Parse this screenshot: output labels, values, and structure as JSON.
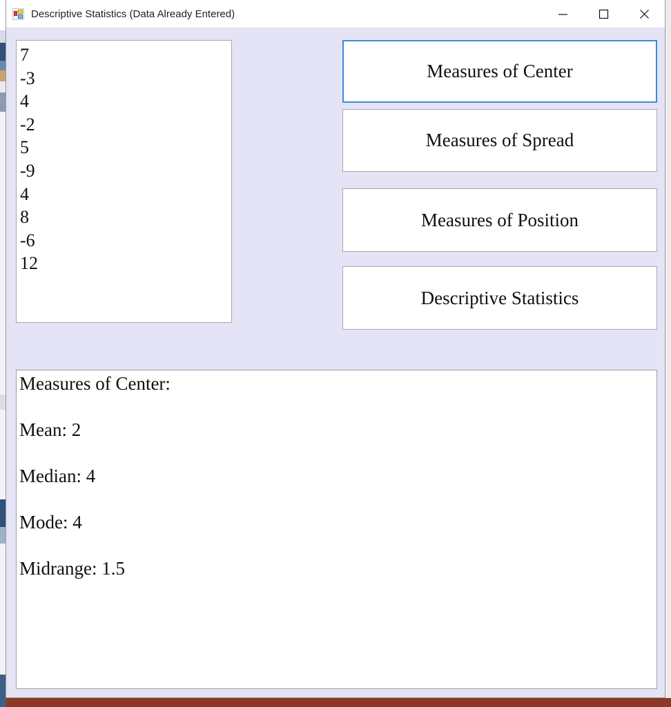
{
  "window": {
    "title": "Descriptive Statistics (Data Already Entered)",
    "icon": "winforms-app-icon",
    "background_color": "#e4e4f6",
    "titlebar_color": "#ffffff",
    "controls": [
      {
        "name": "minimize",
        "glyph": "minimize-icon"
      },
      {
        "name": "maximize",
        "glyph": "maximize-icon"
      },
      {
        "name": "close",
        "glyph": "close-icon"
      }
    ]
  },
  "data_list": {
    "name": "data-values-listbox",
    "values": [
      "7",
      "-3",
      "4",
      "-2",
      "5",
      "-9",
      "4",
      "8",
      "-6",
      "12"
    ]
  },
  "buttons": [
    {
      "id": "measures-of-center",
      "label": "Measures of Center",
      "focused": true,
      "focus_color": "#3d8bd4"
    },
    {
      "id": "measures-of-spread",
      "label": "Measures of Spread",
      "focused": false,
      "border_color": "#a7a7a7"
    },
    {
      "id": "measures-of-position",
      "label": "Measures of Position",
      "focused": false,
      "border_color": "#a7a7a7"
    },
    {
      "id": "descriptive-statistics",
      "label": "Descriptive Statistics",
      "focused": false,
      "border_color": "#a7a7a7"
    }
  ],
  "results": {
    "name": "results-output",
    "heading": "Measures of Center:",
    "lines": [
      "Measures of Center:",
      "",
      "Mean: 2",
      "",
      "Median: 4",
      "",
      "Mode: 4",
      "",
      "Midrange: 1.5"
    ],
    "statistics": {
      "mean": "2",
      "median": "4",
      "mode": "4",
      "midrange": "1.5"
    }
  }
}
